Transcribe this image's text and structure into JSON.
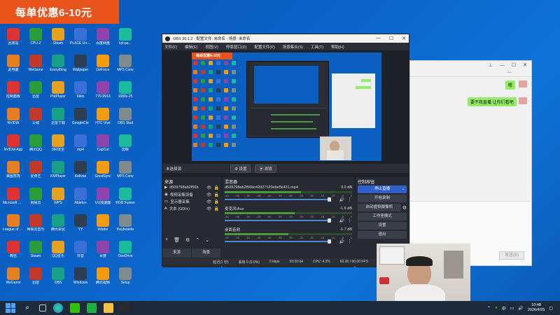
{
  "promo": {
    "text": "每单优惠6-10元"
  },
  "obs": {
    "title": "OBS 30.1.2 - 配置文件: 未命名 - 场景: 未命名",
    "menu": [
      "文件(F)",
      "编辑(E)",
      "视图(V)",
      "停靠窗口(D)",
      "配置文件(P)",
      "场景集合(S)",
      "工具(T)",
      "帮助(H)"
    ],
    "preview_promo": "每单优惠6-10元",
    "scene_bar": {
      "selected": "未选择源",
      "props_button": "设置",
      "filter_button": "滤镜"
    },
    "sources": {
      "title": "来源",
      "items": [
        {
          "name": "d509798ab2f56b",
          "icon": "play"
        },
        {
          "name": "视频采集设备",
          "icon": "camera"
        },
        {
          "name": "显示器采集",
          "icon": "monitor"
        },
        {
          "name": "文本 (GDI+)",
          "icon": "text"
        }
      ],
      "tabs": [
        "来源",
        "场景"
      ]
    },
    "mixer": {
      "title": "混音器",
      "channels": [
        {
          "name": "d509798ab2f56bc42d27120ebe5c431.mp4",
          "db": "0.0 dB",
          "level": 0.6
        },
        {
          "name": "麦克风/Aux",
          "db": "-1.6 dB",
          "level": 0.55
        },
        {
          "name": "桌面音频",
          "db": "-1.7 dB",
          "level": 0.5
        }
      ],
      "scale": [
        "-60",
        "-55",
        "-50",
        "-45",
        "-40",
        "-35",
        "-30",
        "-25",
        "-20",
        "-15",
        "-10",
        "-5",
        "0"
      ]
    },
    "controls": {
      "title": "控制按钮",
      "stop_stream": "停止直播",
      "start_record": "开始录制",
      "virtual_cam": "启动虚拟摄像机",
      "studio_mode": "工作室模式",
      "settings": "设置",
      "exit": "退出"
    },
    "status": {
      "latency": "延迟(1 秒)",
      "dropped": "丢帧 0 (0.0%)",
      "kbps": "0 kbps",
      "time": "00:00:04",
      "cpu": "CPU: 4.3%",
      "fps": "60.00 / 60.00 FPS"
    }
  },
  "chat": {
    "messages": [
      {
        "text": "嗯"
      },
      {
        "text": "要不我直播 让你们看吧"
      }
    ],
    "send_label": "发送(S)"
  },
  "desktop": {
    "rows": [
      [
        "回收站",
        "CPU-Z",
        "Steam",
        "PLACE Unreal",
        "百度网盘",
        "kyl-pa..."
      ],
      [
        "此电脑",
        "WeGame",
        "Everything",
        "Wallpaper",
        "GeForce",
        "MP3 Conv"
      ],
      [
        "控制面板",
        "迅雷",
        "PotPlayer",
        "Kikin",
        "770-9913",
        "1080x-25"
      ],
      [
        "NVIDIA",
        "火绒",
        "迅雷下载",
        "GoogleChr",
        "HTC-Vive",
        "OBS Stud"
      ],
      [
        "NVIDIA App",
        "腾讯QQ",
        "360安全",
        "mp4",
        "CapCut",
        "剪映"
      ],
      [
        "美图秀秀",
        "爱奇艺",
        "KMPlayer",
        "Kolivas",
        "GoodSync",
        "MP3 Conv"
      ],
      [
        "Microsoft Edge",
        "网易云",
        "WPS",
        "Ableton",
        "UU加速器",
        "RGB Fusion"
      ],
      [
        "League of Legends",
        "网易云音乐",
        "腾讯会议",
        "YY",
        "Adobe",
        "Keyboards"
      ],
      [
        "微信",
        "Steam",
        "QQ音乐",
        "抖音",
        "百度",
        "OneDrive"
      ],
      [
        "WeGame",
        "迅雷",
        "OBS",
        "Windows",
        "腾讯视频",
        "Setup"
      ]
    ]
  },
  "taskbar": {
    "time": "10:48",
    "date": "2026/4/25",
    "lang": "中"
  }
}
